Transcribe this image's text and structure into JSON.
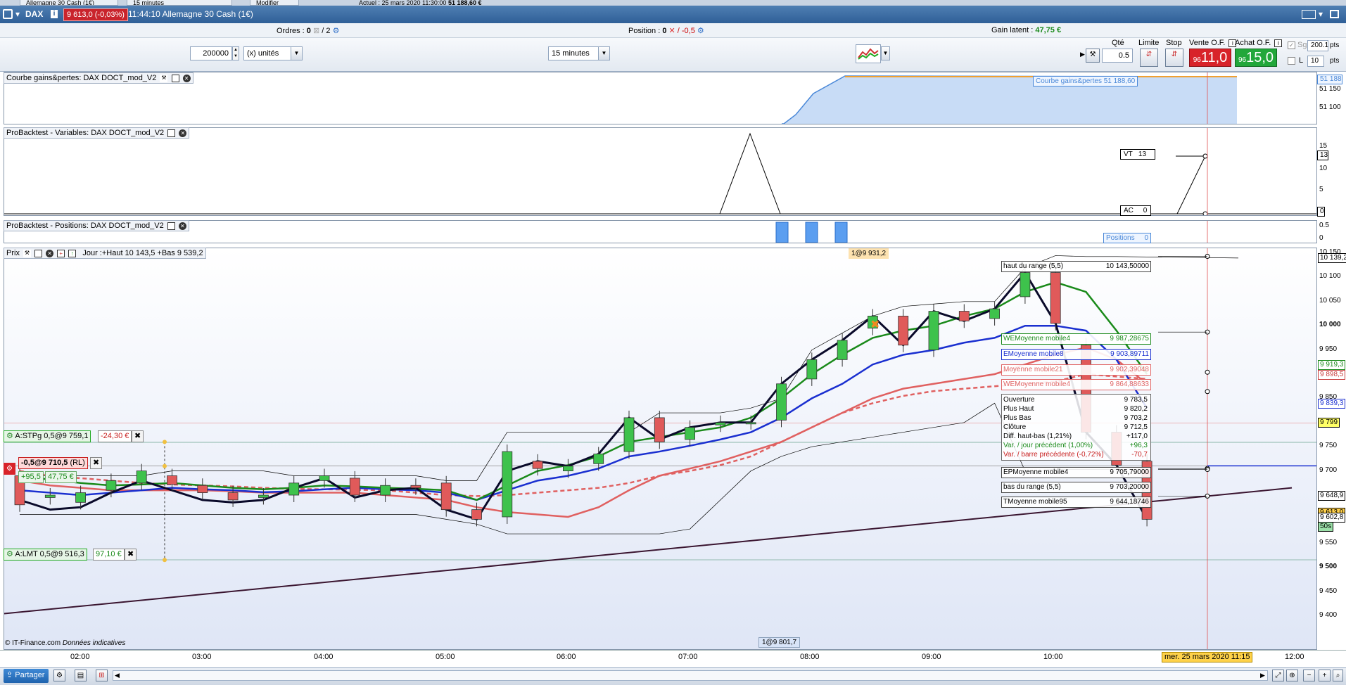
{
  "topstrip": {
    "tab1": "Allemagne 30 Cash (1€)",
    "tab2": "15 minutes",
    "tab3": "Modifier",
    "info": "Actuel : 25 mars 2020 11:30:00",
    "value": "51 188,60 €"
  },
  "titlebar": {
    "symbol": "DAX",
    "price_badge": "9 613,0 (-0,03%)",
    "time_name": "11:44:10 Allemagne 30 Cash (1€)"
  },
  "orders_bar": {
    "ordres_label": "Ordres :",
    "ordres_value": "0",
    "ordres_total": "/ 2",
    "position_label": "Position :",
    "position_value": "0",
    "position_alt": "/ -0,5",
    "gain_label": "Gain latent :",
    "gain_value": "47,75 €"
  },
  "toolbar": {
    "quantity_value": "200000",
    "unit_select": "(x) unités",
    "timeframe_select": "15 minutes",
    "qte_label": "Qté",
    "qte_value": "0.5",
    "limite_label": "Limite",
    "stop_label": "Stop",
    "vente_label": "Vente O.F.",
    "vente_small": "96",
    "vente_big": "11,0",
    "achat_label": "Achat O.F.",
    "achat_small": "96",
    "achat_big": "15,0",
    "sg_label": "Sg",
    "sg_value": "200.1",
    "pts1": "pts",
    "l_label": "L",
    "l_value": "10",
    "pts2": "pts"
  },
  "panels": {
    "gains": {
      "title": "Courbe gains&pertes: DAX DOCT_mod_V2",
      "legend": "Courbe gains&pertes   51 188,60",
      "axis": [
        "51 188",
        "51 150",
        "51 100"
      ]
    },
    "variables": {
      "title": "ProBacktest - Variables: DAX DOCT_mod_V2",
      "vt_label": "VT   13",
      "ac_label": "AC     0",
      "axis": [
        "15",
        "13",
        "10",
        "5",
        "0"
      ]
    },
    "positions": {
      "title": "ProBacktest - Positions: DAX DOCT_mod_V2",
      "legend": "Positions     0",
      "axis": [
        "0.5",
        "0"
      ]
    },
    "price": {
      "title_prefix": "Prix",
      "title_info": "Jour :+Haut 10 143,5 +Bas 9 539,2",
      "marker_top": "1@9 931,2",
      "marker_bottom": "1@9 801,7",
      "copyright": "© IT-Finance.com",
      "copyright_note": "Données indicatives",
      "axis": [
        "10 150",
        "10 100",
        "10 050",
        "10 000",
        "9 950",
        "9 900",
        "9 850",
        "9 800",
        "9 750",
        "9 700",
        "9 650",
        "9 600",
        "9 550",
        "9 500",
        "9 450",
        "9 400"
      ],
      "tags": [
        {
          "text": "10 139,2",
          "color": "#000000",
          "bg": "#ffffff"
        },
        {
          "text": "9 919,3",
          "color": "#1a8a1a",
          "bg": "#ffffff"
        },
        {
          "text": "9 898,5",
          "color": "#c83c3c",
          "bg": "#ffffff"
        },
        {
          "text": "9 839,3",
          "color": "#1a2fd0",
          "bg": "#ffffff"
        },
        {
          "text": "9 799",
          "color": "#000000",
          "bg": "#ffff66"
        },
        {
          "text": "9 648,9",
          "color": "#000000",
          "bg": "#ffffff"
        },
        {
          "text": "9 613,0",
          "color": "#000000",
          "bg": "#ffd04a"
        },
        {
          "text": "9 602,8",
          "color": "#000000",
          "bg": "#ffffff"
        },
        {
          "text": "50s",
          "color": "#000000",
          "bg": "#9be0a8"
        }
      ],
      "legends": [
        {
          "name": "haut du range (5,5)",
          "value": "10 143,50000",
          "color": "#000000"
        },
        {
          "name": "WEMoyenne mobile4",
          "value": "9 987,28675",
          "color": "#1a8a1a"
        },
        {
          "name": "EMoyenne mobile8",
          "value": "9 903,89711",
          "color": "#1a2fd0"
        },
        {
          "name": "Moyenne mobile21",
          "value": "9 902,39048",
          "color": "#e06666"
        },
        {
          "name": "WEMoyenne mobile4",
          "value": "9 864,88633",
          "color": "#e06666"
        },
        {
          "name": "EPMoyenne mobile4",
          "value": "9 705,79000",
          "color": "#000000"
        },
        {
          "name": "bas du range (5,5)",
          "value": "9 703,20000",
          "color": "#000000"
        },
        {
          "name": "TMoyenne mobile95",
          "value": "9 644,18746",
          "color": "#000000"
        }
      ],
      "info": [
        {
          "k": "Ouverture",
          "v": "9 783,5",
          "color": "#000000"
        },
        {
          "k": "Plus Haut",
          "v": "9 820,2",
          "color": "#000000"
        },
        {
          "k": "Plus Bas",
          "v": "9 703,2",
          "color": "#000000"
        },
        {
          "k": "Clôture",
          "v": "9 712,5",
          "color": "#000000"
        },
        {
          "k": "Diff. haut-bas (1,21%)",
          "v": "+117,0",
          "color": "#000000"
        },
        {
          "k": "Var. / jour précédent (1,00%)",
          "v": "+96,3",
          "color": "#1a8a1a"
        },
        {
          "k": "Var. / barre précédente (-0,72%)",
          "v": "-70,7",
          "color": "#c82020"
        }
      ],
      "orders": {
        "stop": {
          "label": "A:STPg  0,5@9 759,1",
          "pnl": "-24,30 €"
        },
        "position": {
          "label": "-0,5@9 710,5",
          "suffix": "(RL)",
          "v1": "+95,5",
          "v2": "47,75 €"
        },
        "limit": {
          "label": "A:LMT  0,5@9 516,3",
          "pnl": "97,10 €"
        }
      }
    }
  },
  "xaxis": {
    "labels": [
      "02:00",
      "03:00",
      "04:00",
      "05:00",
      "06:00",
      "07:00",
      "08:00",
      "09:00",
      "10:00",
      "12:00"
    ],
    "cursor_label": "mer. 25 mars 2020 11:15"
  },
  "bottombar": {
    "share_label": "Partager"
  },
  "candles": [
    {
      "t": 0,
      "o": 9690,
      "c": 9630
    },
    {
      "t": 1,
      "o": 9645,
      "c": 9650
    },
    {
      "t": 2,
      "o": 9635,
      "c": 9655
    },
    {
      "t": 3,
      "o": 9660,
      "c": 9680
    },
    {
      "t": 4,
      "o": 9675,
      "c": 9700
    },
    {
      "t": 5,
      "o": 9690,
      "c": 9672
    },
    {
      "t": 6,
      "o": 9670,
      "c": 9655
    },
    {
      "t": 7,
      "o": 9655,
      "c": 9640
    },
    {
      "t": 8,
      "o": 9645,
      "c": 9650
    },
    {
      "t": 9,
      "o": 9650,
      "c": 9675
    },
    {
      "t": 10,
      "o": 9680,
      "c": 9690
    },
    {
      "t": 11,
      "o": 9685,
      "c": 9650
    },
    {
      "t": 12,
      "o": 9650,
      "c": 9670
    },
    {
      "t": 13,
      "o": 9670,
      "c": 9665
    },
    {
      "t": 14,
      "o": 9675,
      "c": 9620
    },
    {
      "t": 15,
      "o": 9620,
      "c": 9600
    },
    {
      "t": 16,
      "o": 9605,
      "c": 9740
    },
    {
      "t": 17,
      "o": 9720,
      "c": 9705
    },
    {
      "t": 18,
      "o": 9700,
      "c": 9710
    },
    {
      "t": 19,
      "o": 9715,
      "c": 9735
    },
    {
      "t": 20,
      "o": 9740,
      "c": 9810
    },
    {
      "t": 21,
      "o": 9810,
      "c": 9760
    },
    {
      "t": 22,
      "o": 9765,
      "c": 9790
    },
    {
      "t": 23,
      "o": 9795,
      "c": 9800
    },
    {
      "t": 24,
      "o": 9800,
      "c": 9800
    },
    {
      "t": 25,
      "o": 9805,
      "c": 9880
    },
    {
      "t": 26,
      "o": 9890,
      "c": 9930
    },
    {
      "t": 27,
      "o": 9930,
      "c": 9970
    },
    {
      "t": 28,
      "o": 9995,
      "c": 10020
    },
    {
      "t": 29,
      "o": 10020,
      "c": 9960
    },
    {
      "t": 30,
      "o": 9950,
      "c": 10030
    },
    {
      "t": 31,
      "o": 10030,
      "c": 10010
    },
    {
      "t": 32,
      "o": 10015,
      "c": 10035
    },
    {
      "t": 33,
      "o": 10060,
      "c": 10110
    },
    {
      "t": 34,
      "o": 10110,
      "c": 10005
    },
    {
      "t": 35,
      "o": 9960,
      "c": 9780
    },
    {
      "t": 36,
      "o": 9780,
      "c": 9712
    },
    {
      "t": 37,
      "o": 9720,
      "c": 9600
    }
  ]
}
